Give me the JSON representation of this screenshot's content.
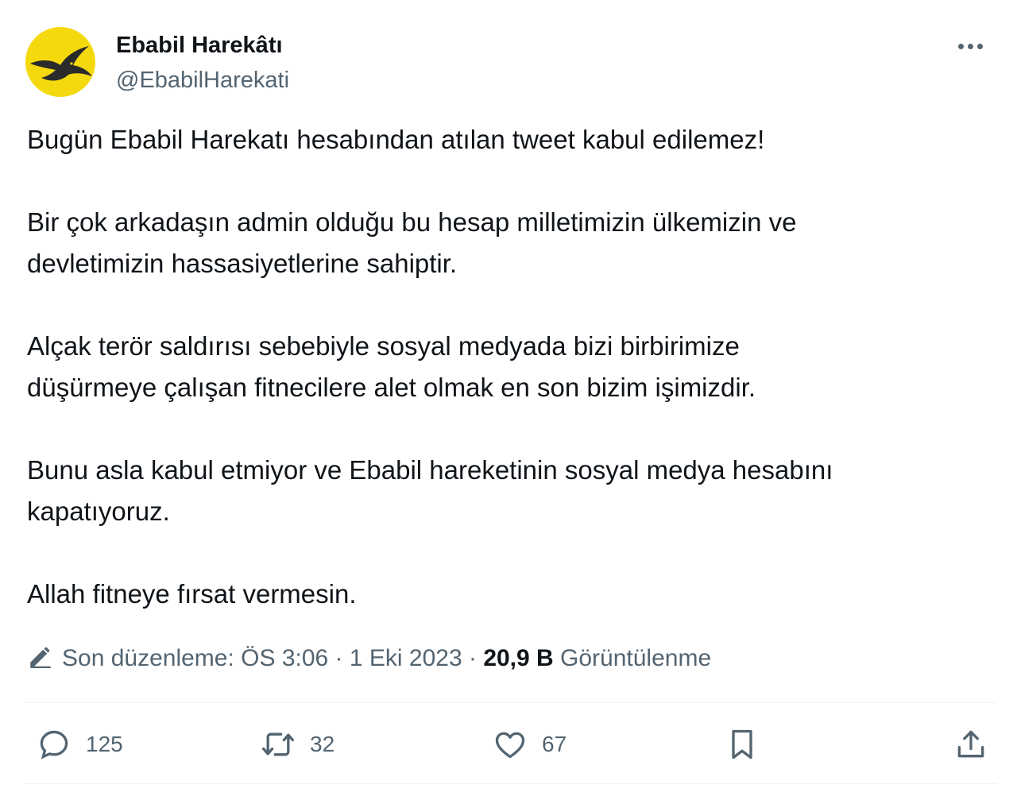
{
  "user": {
    "display_name": "Ebabil Harekâtı",
    "handle": "@EbabilHarekati",
    "avatar_icon": "swallow-bird-logo",
    "avatar_bg": "#f5d90f"
  },
  "more_icon": "more-horizontal-icon",
  "tweet": {
    "paragraphs": [
      "Bugün Ebabil Harekatı hesabından atılan tweet kabul edilemez!",
      "Bir çok arkadaşın admin olduğu bu hesap milletimizin ülkemizin ve\ndevletimizin hassasiyetlerine sahiptir.",
      "Alçak terör saldırısı sebebiyle sosyal medyada  bizi birbirimize\ndüşürmeye çalışan fitnecilere alet olmak en son bizim işimizdir.",
      "Bunu asla kabul etmiyor ve Ebabil hareketinin sosyal medya hesabını\nkapatıyoruz.",
      "Allah fitneye fırsat vermesin."
    ]
  },
  "meta": {
    "edit_icon": "pencil-icon",
    "edited_prefix": "Son düzenleme: ÖS 3:06 · 1 Eki 2023 · ",
    "views_count": "20,9 B",
    "views_label": " Görüntülenme"
  },
  "actions": {
    "reply": {
      "icon": "reply-icon",
      "count": "125"
    },
    "retweet": {
      "icon": "retweet-icon",
      "count": "32"
    },
    "like": {
      "icon": "heart-icon",
      "count": "67"
    },
    "bookmark": {
      "icon": "bookmark-icon"
    },
    "share": {
      "icon": "share-icon"
    }
  },
  "colors": {
    "text": "#0f1419",
    "secondary": "#536471",
    "divider": "#eff3f4"
  }
}
